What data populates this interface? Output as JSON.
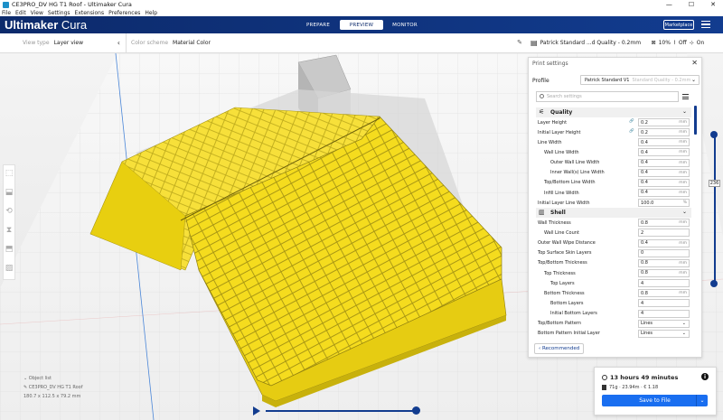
{
  "window": {
    "title": "CE3PRO_DV HG T1 Roof - Ultimaker Cura",
    "min": "—",
    "max": "☐",
    "close": "✕"
  },
  "menu": [
    "File",
    "Edit",
    "View",
    "Settings",
    "Extensions",
    "Preferences",
    "Help"
  ],
  "header": {
    "brand_bold": "Ultimaker",
    "brand_light": "Cura",
    "tabs": [
      "PREPARE",
      "PREVIEW",
      "MONITOR"
    ],
    "active_tab": "PREVIEW",
    "marketplace": "Marketplace"
  },
  "viewbar": {
    "view_type_label": "View type",
    "view_type_value": "Layer view",
    "color_scheme_label": "Color scheme",
    "color_scheme_value": "Material Color"
  },
  "summary": {
    "profile": "Patrick Standard ...d Quality - 0.2mm",
    "infill": "10%",
    "support": "Off",
    "adhesion": "On"
  },
  "panel": {
    "title": "Print settings",
    "profile_label": "Profile",
    "profile_value": "Patrick Standard V1",
    "profile_hint": "Standard Quality - 0.2mm",
    "search_placeholder": "Search settings",
    "recommended": "Recommended",
    "categories": [
      {
        "name": "Quality",
        "icon": "⚟",
        "rows": [
          {
            "label": "Layer Height",
            "value": "0.2",
            "unit": "mm",
            "indent": 0,
            "link": true
          },
          {
            "label": "Initial Layer Height",
            "value": "0.2",
            "unit": "mm",
            "indent": 0,
            "link": true
          },
          {
            "label": "Line Width",
            "value": "0.4",
            "unit": "mm",
            "indent": 0
          },
          {
            "label": "Wall Line Width",
            "value": "0.4",
            "unit": "mm",
            "indent": 1
          },
          {
            "label": "Outer Wall Line Width",
            "value": "0.4",
            "unit": "mm",
            "indent": 2
          },
          {
            "label": "Inner Wall(s) Line Width",
            "value": "0.4",
            "unit": "mm",
            "indent": 2
          },
          {
            "label": "Top/Bottom Line Width",
            "value": "0.4",
            "unit": "mm",
            "indent": 1
          },
          {
            "label": "Infill Line Width",
            "value": "0.4",
            "unit": "mm",
            "indent": 1
          },
          {
            "label": "Initial Layer Line Width",
            "value": "100.0",
            "unit": "%",
            "indent": 0
          }
        ]
      },
      {
        "name": "Shell",
        "icon": "▥",
        "rows": [
          {
            "label": "Wall Thickness",
            "value": "0.8",
            "unit": "mm",
            "indent": 0
          },
          {
            "label": "Wall Line Count",
            "value": "2",
            "unit": "",
            "indent": 1
          },
          {
            "label": "Outer Wall Wipe Distance",
            "value": "0.4",
            "unit": "mm",
            "indent": 0
          },
          {
            "label": "Top Surface Skin Layers",
            "value": "0",
            "unit": "",
            "indent": 0
          },
          {
            "label": "Top/Bottom Thickness",
            "value": "0.8",
            "unit": "mm",
            "indent": 0
          },
          {
            "label": "Top Thickness",
            "value": "0.8",
            "unit": "mm",
            "indent": 1
          },
          {
            "label": "Top Layers",
            "value": "4",
            "unit": "",
            "indent": 2
          },
          {
            "label": "Bottom Thickness",
            "value": "0.8",
            "unit": "mm",
            "indent": 1
          },
          {
            "label": "Bottom Layers",
            "value": "4",
            "unit": "",
            "indent": 2
          },
          {
            "label": "Initial Bottom Layers",
            "value": "4",
            "unit": "",
            "indent": 2
          },
          {
            "label": "Top/Bottom Pattern",
            "value": "Lines",
            "unit": "",
            "indent": 0,
            "dropdown": true
          },
          {
            "label": "Bottom Pattern Initial Layer",
            "value": "Lines",
            "unit": "",
            "indent": 0,
            "dropdown": true
          }
        ]
      }
    ]
  },
  "object": {
    "list_label": "Object list",
    "name": "CE3PRO_DV HG T1 Roof",
    "dims": "180.7 x 112.5 x 79.2 mm"
  },
  "layer_slider_value": "236",
  "save": {
    "time": "13 hours 49 minutes",
    "material": "71g · 23.94m · € 1.18",
    "button": "Save to File"
  },
  "colors": {
    "accent": "#196ef0",
    "header": "#0c2a6b",
    "model": "#f5dc1e"
  }
}
